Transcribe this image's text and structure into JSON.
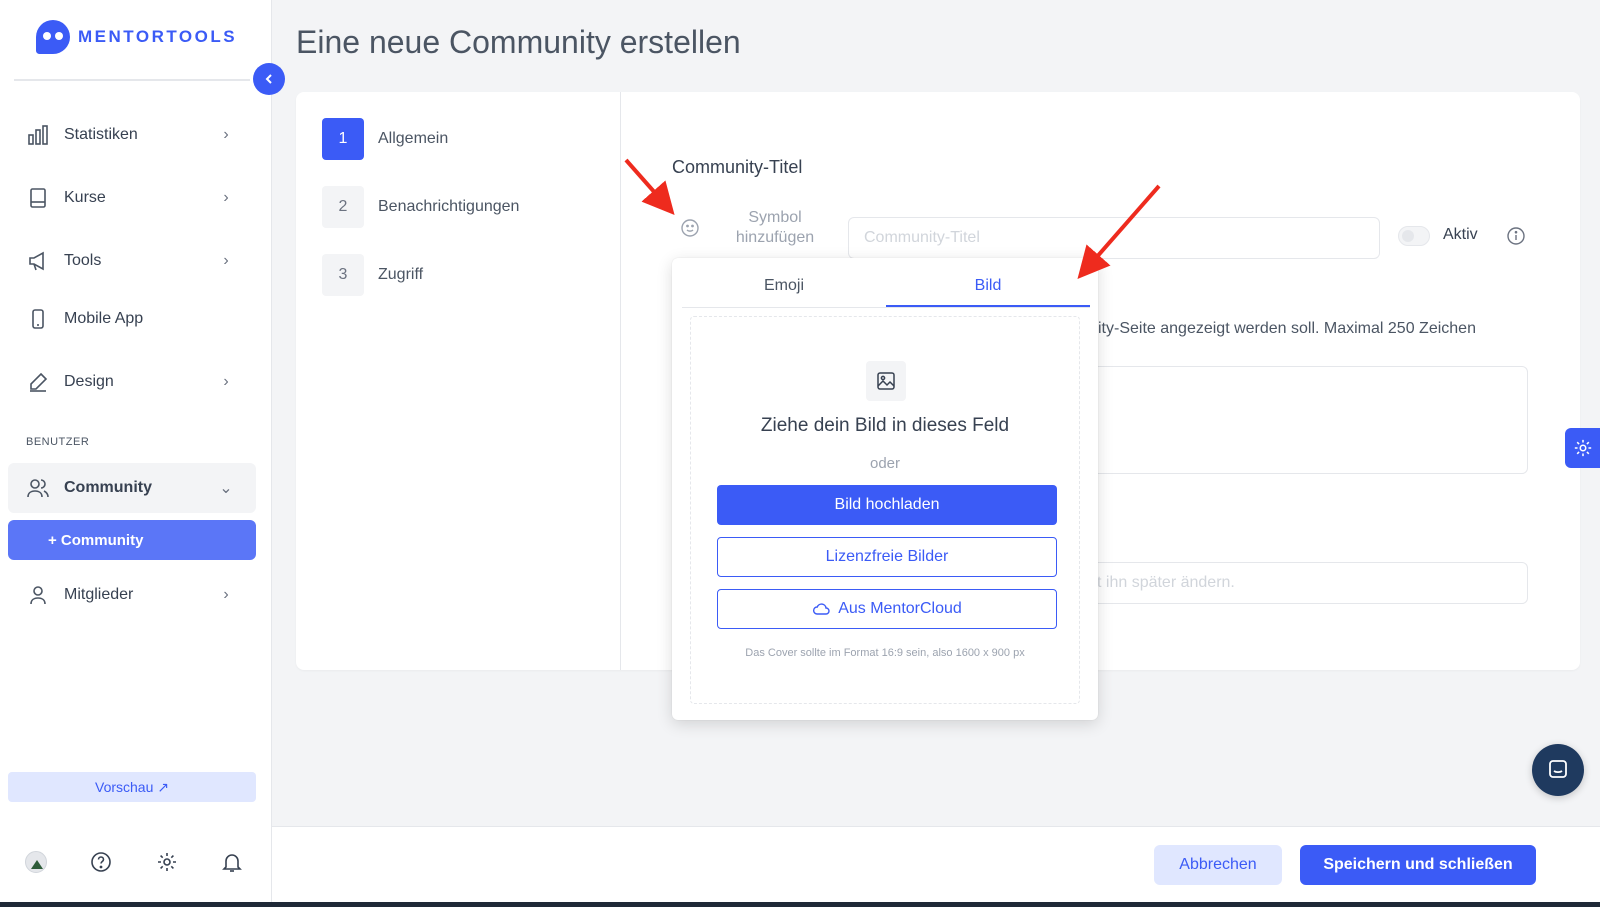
{
  "brand": {
    "name": "MENTORTOOLS",
    "accent": "#3b5bf6"
  },
  "sidebar": {
    "items": [
      {
        "label": "Statistiken",
        "icon": "bar-chart-icon"
      },
      {
        "label": "Kurse",
        "icon": "book-icon"
      },
      {
        "label": "Tools",
        "icon": "megaphone-icon"
      },
      {
        "label": "Mobile App",
        "icon": "phone-icon"
      },
      {
        "label": "Design",
        "icon": "pencil-icon"
      }
    ],
    "section_label": "BENUTZER",
    "community": {
      "label": "Community",
      "icon": "users-icon"
    },
    "sub_item": "+ Community",
    "members": {
      "label": "Mitglieder",
      "icon": "user-icon"
    },
    "preview_label": "Vorschau ↗"
  },
  "page": {
    "title": "Eine neue Community erstellen"
  },
  "steps": [
    {
      "number": "1",
      "label": "Allgemein"
    },
    {
      "number": "2",
      "label": "Benachrichtigungen"
    },
    {
      "number": "3",
      "label": "Zugriff"
    }
  ],
  "form": {
    "title_label": "Community-Titel",
    "symbol_label_line1": "Symbol",
    "symbol_label_line2": "hinzufügen",
    "title_placeholder": "Community-Titel",
    "active_label": "Aktiv",
    "description_hint": "ity-Seite angezeigt werden soll. Maximal 250 Zeichen",
    "slug_hint": "t ihn später ändern."
  },
  "popover": {
    "tabs": [
      "Emoji",
      "Bild"
    ],
    "active_tab": "Bild",
    "drop_title": "Ziehe dein Bild in dieses Feld",
    "or_text": "oder",
    "upload_button": "Bild hochladen",
    "free_images_button": "Lizenzfreie Bilder",
    "cloud_button": "Aus MentorCloud",
    "hint": "Das Cover sollte im Format 16:9 sein, also 1600 x 900 px"
  },
  "footer": {
    "cancel_label": "Abbrechen",
    "save_label": "Speichern und schließen"
  }
}
